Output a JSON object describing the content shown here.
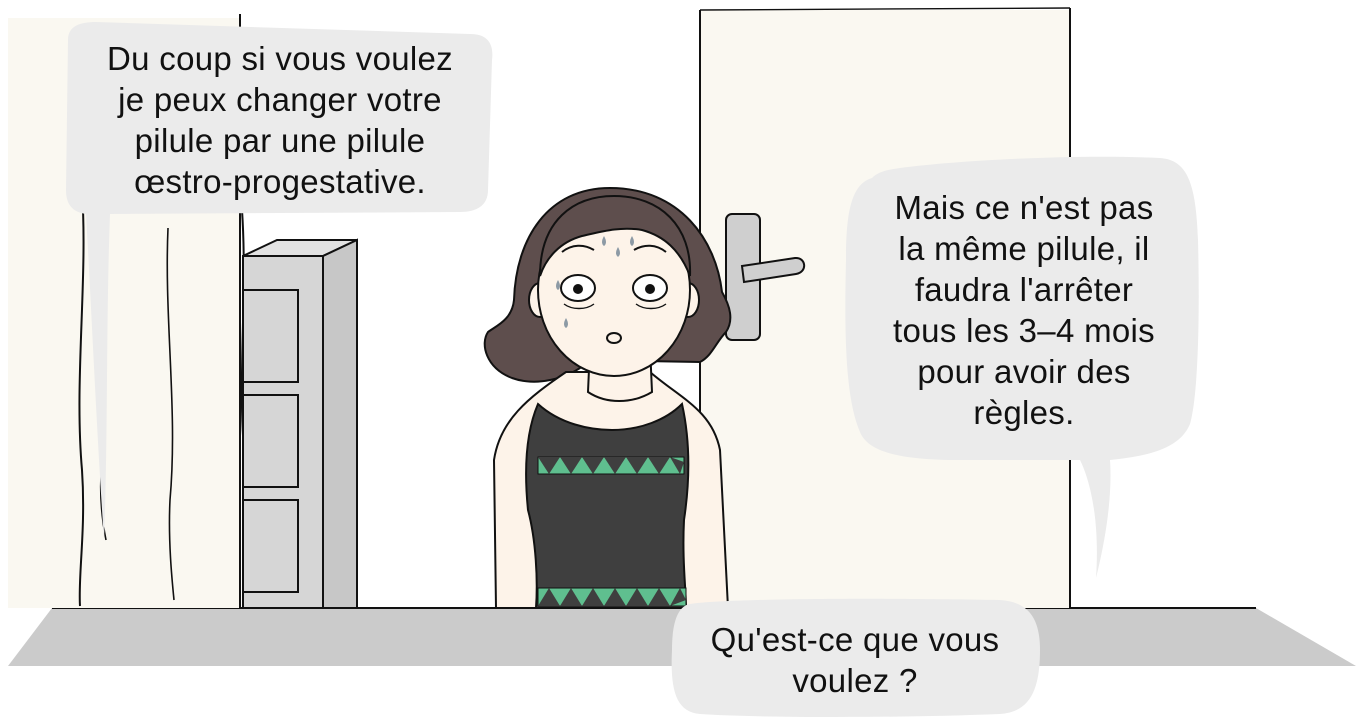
{
  "panel": {
    "bubbles": [
      {
        "speaker": "doctor",
        "text": "Du coup si vous voulez\nje peux changer votre\npilule par une pilule\nœstro-progestative."
      },
      {
        "speaker": "patient",
        "text": "Mais ce n'est pas\nla même pilule, il\nfaudra l'arrêter\ntous les 3–4 mois\npour avoir des\nrègles."
      },
      {
        "speaker": "doctor",
        "text": "Qu'est-ce que vous\nvoulez ?"
      }
    ]
  },
  "colors": {
    "bubble": "#ebebeb",
    "hair": "#5e4e4d",
    "skin": "#fdf3e9",
    "dress": "#3f3f3f",
    "dress_pattern": "#5fbf8f",
    "wall_panel": "#faf8f1",
    "floor": "#cbcbcb",
    "shelf": "#d3d3d3",
    "sweat": "#8d9aa5"
  }
}
